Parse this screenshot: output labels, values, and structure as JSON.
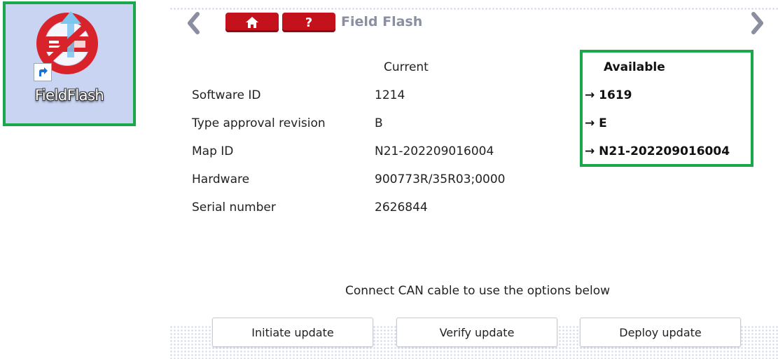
{
  "desktop": {
    "shortcut_label": "FieldFlash",
    "icon": "fieldflash-app-icon",
    "shortcut_badge_icon": "shortcut-arrow-icon",
    "highlight_color": "#1aa84a"
  },
  "toolbar": {
    "back_icon": "chevron-left-icon",
    "forward_icon": "chevron-right-icon",
    "home_icon": "home-icon",
    "help_label": "?",
    "title": "Field Flash",
    "accent_color": "#c4121d"
  },
  "info": {
    "current_header": "Current",
    "available_header": "Available",
    "rows": [
      {
        "label": "Software ID",
        "current": "1214",
        "available": "→ 1619"
      },
      {
        "label": "Type approval revision",
        "current": "B",
        "available": "→ E"
      },
      {
        "label": "Map ID",
        "current": "N21-202209016004",
        "available": "→ N21-202209016004"
      },
      {
        "label": "Hardware",
        "current": "900773R/35R03;0000"
      },
      {
        "label": "Serial number",
        "current": "2626844"
      }
    ]
  },
  "message": "Connect CAN cable to use the options below",
  "actions": {
    "initiate": "Initiate update",
    "verify": "Verify update",
    "deploy": "Deploy update"
  }
}
